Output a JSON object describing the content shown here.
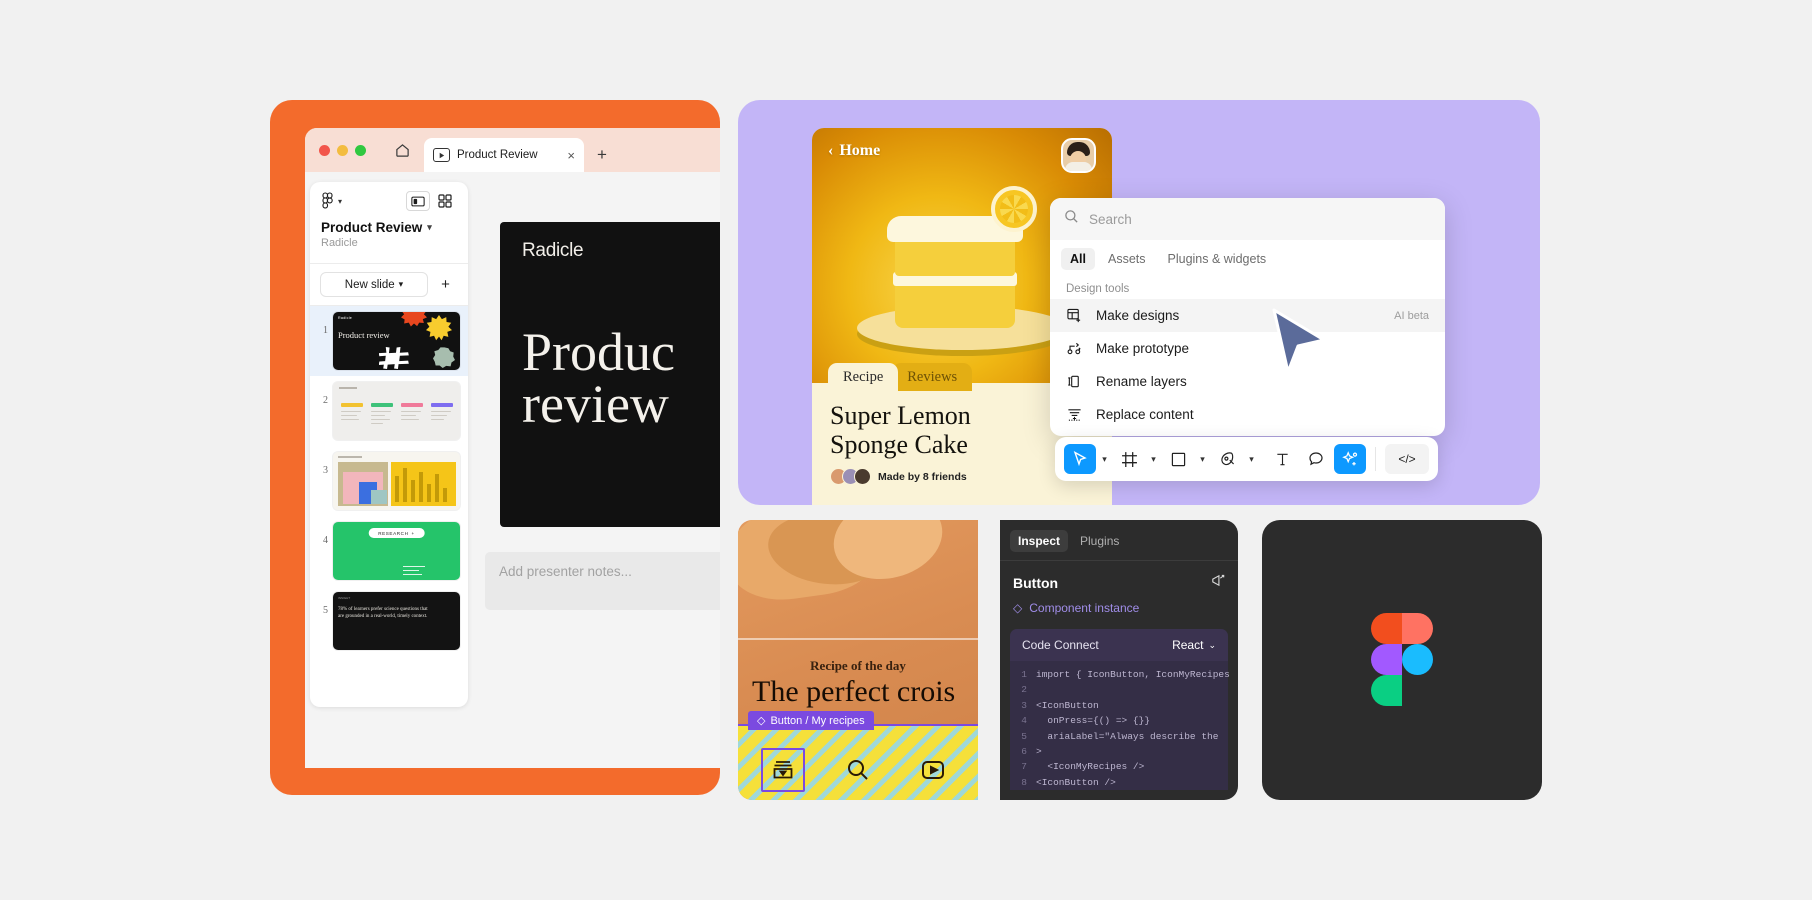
{
  "browser": {
    "tab_title": "Product Review",
    "tab_close": "×",
    "new_tab": "+",
    "home_icon": "home-icon"
  },
  "slides_panel": {
    "file_title": "Product Review",
    "team": "Radicle",
    "new_slide_label": "New slide",
    "add_label": "+",
    "caret": "⌄",
    "slides": [
      {
        "num": "1",
        "title": "Product review",
        "brand": "Radicle"
      },
      {
        "num": "2",
        "title": ""
      },
      {
        "num": "3",
        "title": ""
      },
      {
        "num": "4",
        "badge": "RESEARCH"
      },
      {
        "num": "5",
        "label": "INSIGHT",
        "body": "78% of learners prefer science questions that are grounded in a real-world, timely context."
      }
    ]
  },
  "editor": {
    "slide_brand": "Radicle",
    "slide_heading_line1": "Produc",
    "slide_heading_line2": "review",
    "notes_placeholder": "Add presenter notes..."
  },
  "recipe_app": {
    "back_label": "Home",
    "back_chevron": "‹",
    "tabs": [
      {
        "label": "Recipe",
        "active": true
      },
      {
        "label": "Reviews",
        "active": false
      }
    ],
    "title_line1": "Super Lemon",
    "title_line2": "Sponge Cake",
    "made_by": "Made by 8 friends"
  },
  "palette": {
    "search_placeholder": "Search",
    "tabs": [
      {
        "label": "All",
        "active": true
      },
      {
        "label": "Assets",
        "active": false
      },
      {
        "label": "Plugins & widgets",
        "active": false
      }
    ],
    "group_label": "Design tools",
    "items": [
      {
        "label": "Make designs",
        "badge": "AI beta",
        "icon": "make-designs-icon",
        "highlighted": true
      },
      {
        "label": "Make prototype",
        "badge": "",
        "icon": "make-prototype-icon",
        "highlighted": false
      },
      {
        "label": "Rename layers",
        "badge": "",
        "icon": "rename-layers-icon",
        "highlighted": false
      },
      {
        "label": "Replace content",
        "badge": "",
        "icon": "replace-content-icon",
        "highlighted": false
      }
    ]
  },
  "toolbar": {
    "tools": [
      {
        "name": "move-tool",
        "active": true,
        "caret": true
      },
      {
        "name": "frame-tool",
        "active": false,
        "caret": true
      },
      {
        "name": "shape-tool",
        "active": false,
        "caret": true
      },
      {
        "name": "pen-tool",
        "active": false,
        "caret": true
      },
      {
        "name": "text-tool",
        "active": false,
        "caret": false
      },
      {
        "name": "comment-tool",
        "active": false,
        "caret": false
      },
      {
        "name": "actions-ai-tool",
        "active": true,
        "caret": false
      }
    ],
    "dev_mode_label": "</>",
    "accent_color": "#0d99ff"
  },
  "croissant_card": {
    "eyebrow": "Recipe of the day",
    "headline": "The perfect crois",
    "layer_tag": "Button / My recipes",
    "tag_diamond": "◇",
    "icons": [
      "my-recipes-icon",
      "search-icon",
      "play-icon"
    ],
    "selection_color": "#7b4ae0"
  },
  "inspect_panel": {
    "tabs": [
      {
        "label": "Inspect",
        "active": true
      },
      {
        "label": "Plugins",
        "active": false
      }
    ],
    "node_name": "Button",
    "node_type": "Component instance",
    "node_type_diamond": "◇",
    "code_connect_label": "Code Connect",
    "framework": "React",
    "framework_caret": "⌄",
    "code_lines": [
      {
        "n": "1",
        "text": "import { IconButton, IconMyRecipes"
      },
      {
        "n": "2",
        "text": ""
      },
      {
        "n": "3",
        "text": "<IconButton"
      },
      {
        "n": "4",
        "text": "  onPress={() => {}}"
      },
      {
        "n": "5",
        "text": "  ariaLabel=\"Always describe the "
      },
      {
        "n": "6",
        "text": ">"
      },
      {
        "n": "7",
        "text": "  <IconMyRecipes />"
      },
      {
        "n": "8",
        "text": "<IconButton />"
      }
    ]
  },
  "logo_card": {
    "logo_name": "figma-logo",
    "colors": [
      "#f24e1e",
      "#ff7262",
      "#a259ff",
      "#1abcfe",
      "#0acf83"
    ]
  },
  "palette_colors": {
    "orange_card": "#f36b2c",
    "purple_card": "#c3b5f7",
    "page_bg": "#f1f1f1"
  }
}
